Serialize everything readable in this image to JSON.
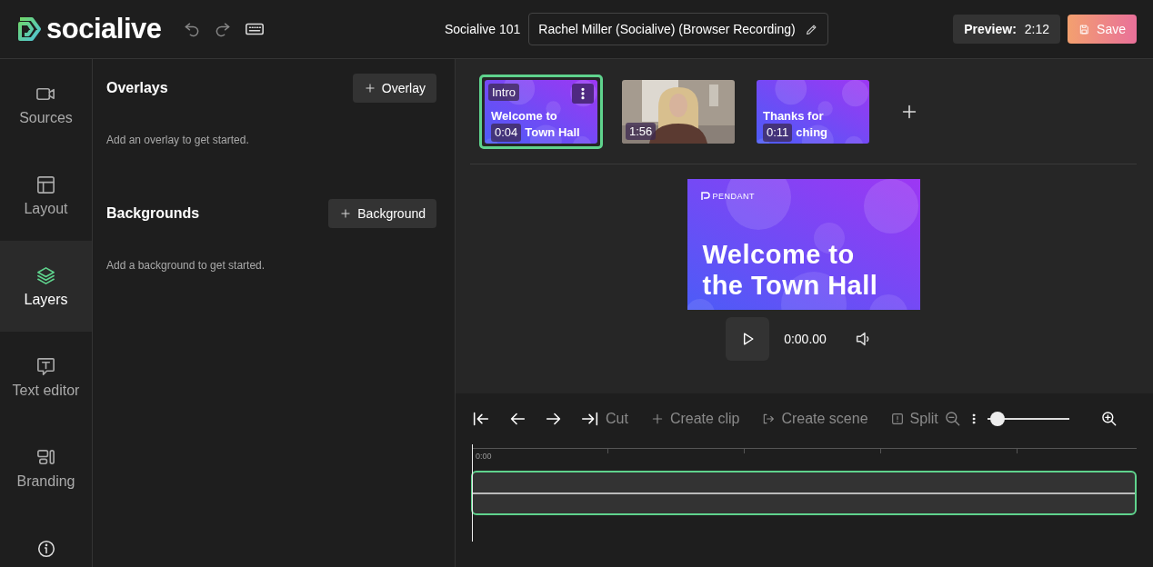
{
  "header": {
    "logo": "socialive",
    "project": "Socialive 101",
    "recording_title": "Rachel Miller (Socialive) (Browser Recording)",
    "preview_label": "Preview:",
    "preview_duration": "2:12",
    "save_label": "Save"
  },
  "nav": [
    {
      "kind": "page",
      "label": "Sources",
      "selected": false
    },
    {
      "kind": "page",
      "label": "Layout",
      "selected": false
    },
    {
      "kind": "page",
      "label": "Layers",
      "selected": true
    },
    {
      "kind": "page",
      "label": "Text editor",
      "selected": false
    },
    {
      "kind": "page",
      "label": "Branding",
      "selected": false
    },
    {
      "kind": "info",
      "selected": false
    }
  ],
  "panel": {
    "sections": [
      {
        "title": "Overlays",
        "button": "Overlay",
        "empty_text": "Add an overlay to get started."
      },
      {
        "title": "Backgrounds",
        "button": "Background",
        "empty_text": "Add a background to get started."
      }
    ]
  },
  "scenes": [
    {
      "kind": "slide",
      "label": "Intro",
      "duration": "0:04",
      "lines": [
        "Welcome to",
        "Town Hall"
      ],
      "selected": true
    },
    {
      "kind": "video",
      "duration": "1:56",
      "selected": false
    },
    {
      "kind": "slide",
      "duration": "0:11",
      "lines": [
        "Thanks for",
        "ching"
      ],
      "selected": false
    }
  ],
  "preview": {
    "brand": "PENDANT",
    "lines": [
      "Welcome to",
      "the Town Hall"
    ],
    "timecode": "0:00.00"
  },
  "timeline": {
    "tools": [
      {
        "kind": "icon",
        "disabled": false
      },
      {
        "kind": "icon",
        "disabled": false
      },
      {
        "kind": "icon",
        "disabled": false
      },
      {
        "kind": "text",
        "label": "Cut",
        "disabled": true
      },
      {
        "kind": "text",
        "label": "Create clip",
        "disabled": true
      },
      {
        "kind": "text",
        "label": "Create scene",
        "disabled": true
      },
      {
        "kind": "text",
        "label": "Split",
        "disabled": true
      }
    ],
    "zoom": {
      "level": 0.04
    },
    "ruler": [
      "0:00"
    ]
  }
}
